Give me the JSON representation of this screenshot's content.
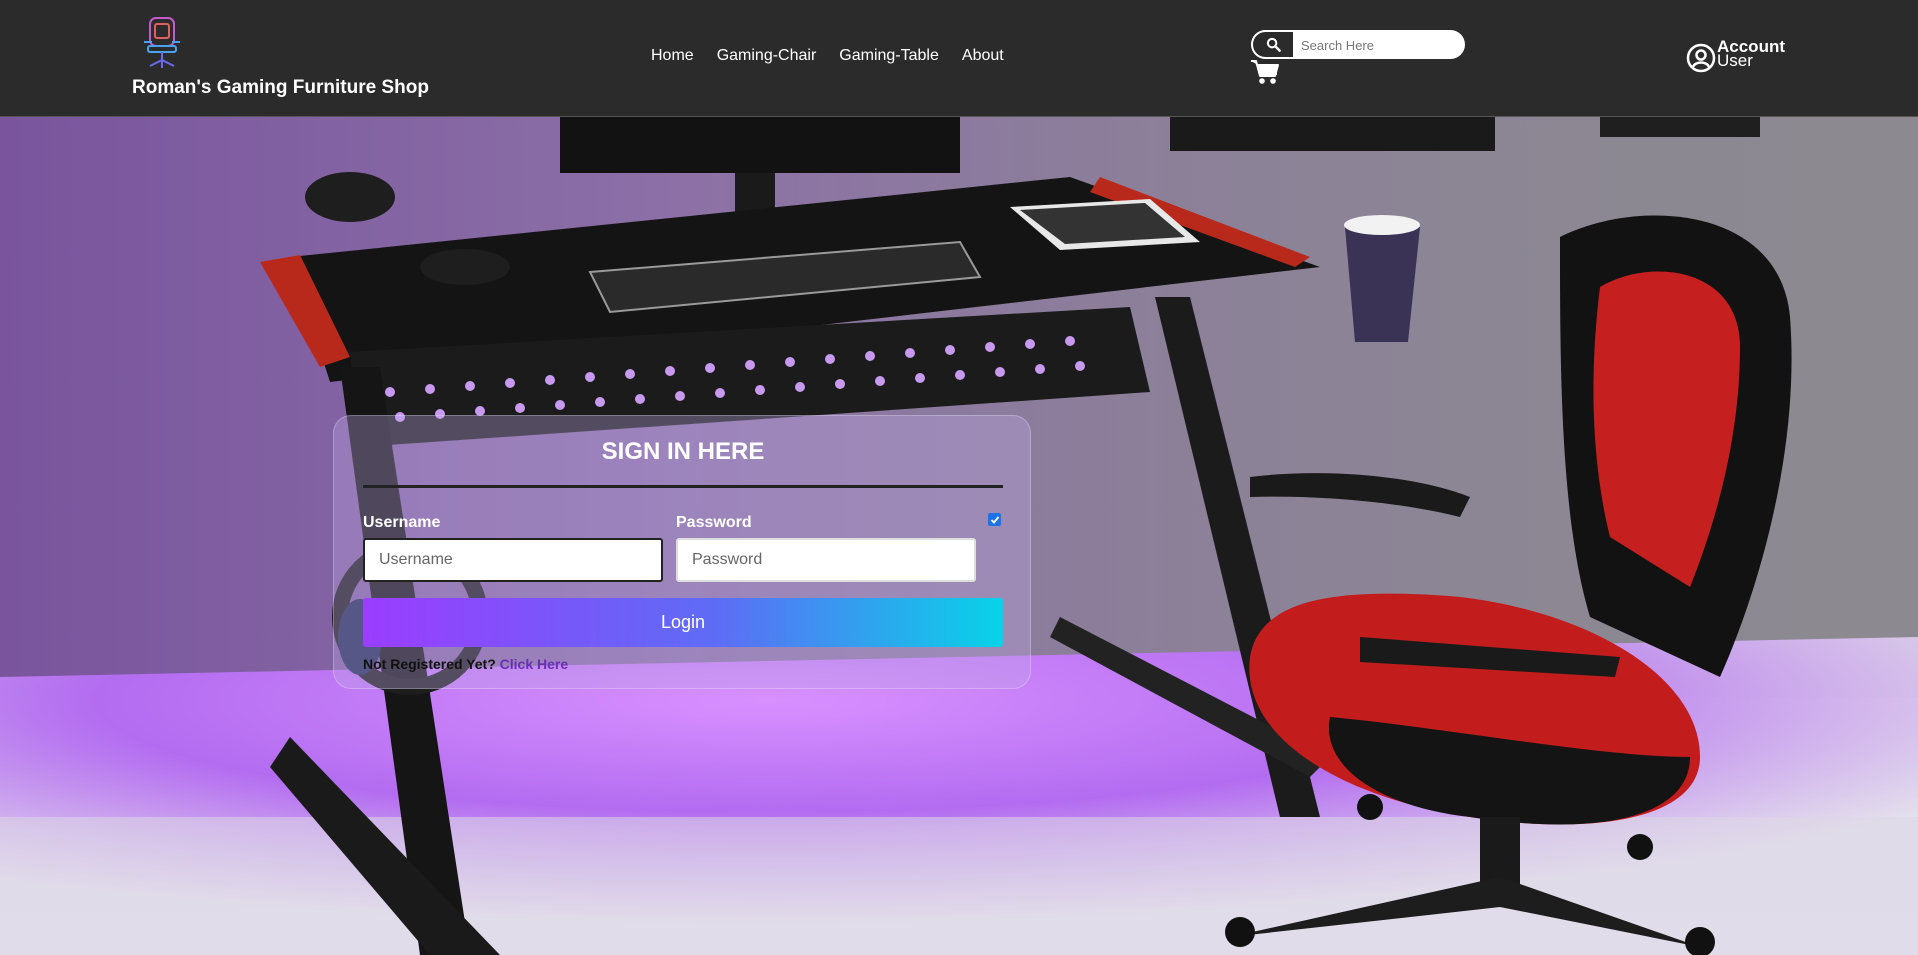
{
  "header": {
    "brand": "Roman's Gaming Furniture Shop",
    "nav": [
      "Home",
      "Gaming-Chair",
      "Gaming-Table",
      "About"
    ],
    "search_placeholder": "Search Here",
    "account_line1": "Account",
    "account_line2": "User"
  },
  "signin": {
    "title": "SIGN IN HERE",
    "username_label": "Username",
    "username_placeholder": "Username",
    "password_label": "Password",
    "password_placeholder": "Password",
    "login_label": "Login",
    "register_prompt": "Not Registered Yet?",
    "register_link": "Click Here"
  },
  "colors": {
    "header_bg": "#2b2b2b",
    "login_gradient_start": "#9b3dff",
    "login_gradient_end": "#07d3e8",
    "link": "#6a2db5"
  },
  "icons": [
    "gaming-chair-logo-icon",
    "search-icon",
    "cart-icon",
    "account-circle-icon",
    "checkbox-icon"
  ]
}
